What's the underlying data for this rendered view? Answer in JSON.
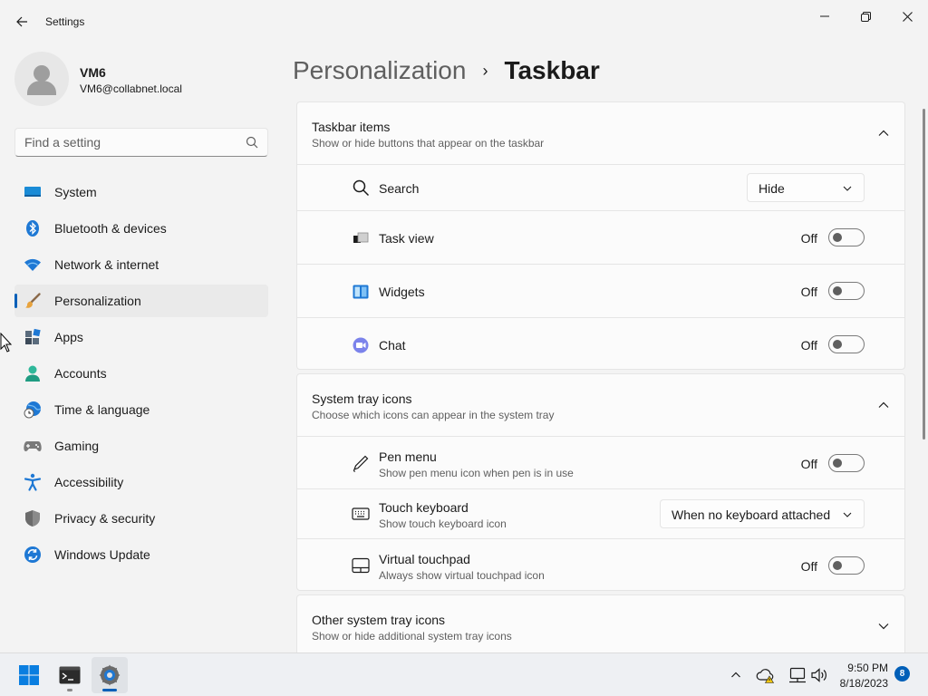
{
  "window": {
    "title": "Settings"
  },
  "profile": {
    "name": "VM6",
    "email": "VM6@collabnet.local"
  },
  "search": {
    "placeholder": "Find a setting"
  },
  "nav": {
    "items": [
      {
        "label": "System",
        "icon": "system-icon"
      },
      {
        "label": "Bluetooth & devices",
        "icon": "bluetooth-icon"
      },
      {
        "label": "Network & internet",
        "icon": "wifi-icon"
      },
      {
        "label": "Personalization",
        "icon": "brush-icon",
        "active": true
      },
      {
        "label": "Apps",
        "icon": "apps-icon"
      },
      {
        "label": "Accounts",
        "icon": "account-icon"
      },
      {
        "label": "Time & language",
        "icon": "globe-clock-icon"
      },
      {
        "label": "Gaming",
        "icon": "gamepad-icon"
      },
      {
        "label": "Accessibility",
        "icon": "accessibility-icon"
      },
      {
        "label": "Privacy & security",
        "icon": "shield-icon"
      },
      {
        "label": "Windows Update",
        "icon": "update-icon"
      }
    ]
  },
  "header": {
    "parent": "Personalization",
    "separator": "›",
    "current": "Taskbar"
  },
  "taskbar_items": {
    "title": "Taskbar items",
    "description": "Show or hide buttons that appear on the taskbar",
    "rows": [
      {
        "label": "Search",
        "control": "dropdown",
        "value": "Hide",
        "icon": "search-icon"
      },
      {
        "label": "Task view",
        "control": "toggle",
        "state": "Off",
        "icon": "task-view-icon"
      },
      {
        "label": "Widgets",
        "control": "toggle",
        "state": "Off",
        "icon": "widgets-icon"
      },
      {
        "label": "Chat",
        "control": "toggle",
        "state": "Off",
        "icon": "chat-icon"
      }
    ]
  },
  "system_tray": {
    "title": "System tray icons",
    "description": "Choose which icons can appear in the system tray",
    "rows": [
      {
        "label": "Pen menu",
        "sub": "Show pen menu icon when pen is in use",
        "control": "toggle",
        "state": "Off",
        "icon": "pen-icon"
      },
      {
        "label": "Touch keyboard",
        "sub": "Show touch keyboard icon",
        "control": "dropdown",
        "value": "When no keyboard attached",
        "icon": "keyboard-icon"
      },
      {
        "label": "Virtual touchpad",
        "sub": "Always show virtual touchpad icon",
        "control": "toggle",
        "state": "Off",
        "icon": "touchpad-icon"
      }
    ]
  },
  "other_tray": {
    "title": "Other system tray icons",
    "description": "Show or hide additional system tray icons"
  },
  "os_taskbar": {
    "apps": [
      {
        "name": "start-button",
        "icon": "windows-logo-icon"
      },
      {
        "name": "terminal-app",
        "icon": "terminal-icon"
      },
      {
        "name": "settings-app",
        "icon": "settings-gear-icon",
        "active": true
      }
    ],
    "clock": {
      "time": "9:50 PM",
      "date": "8/18/2023"
    },
    "notification_count": "8"
  },
  "colors": {
    "accent": "#005fb8",
    "background": "#f3f3f3",
    "card": "#fbfbfb"
  }
}
